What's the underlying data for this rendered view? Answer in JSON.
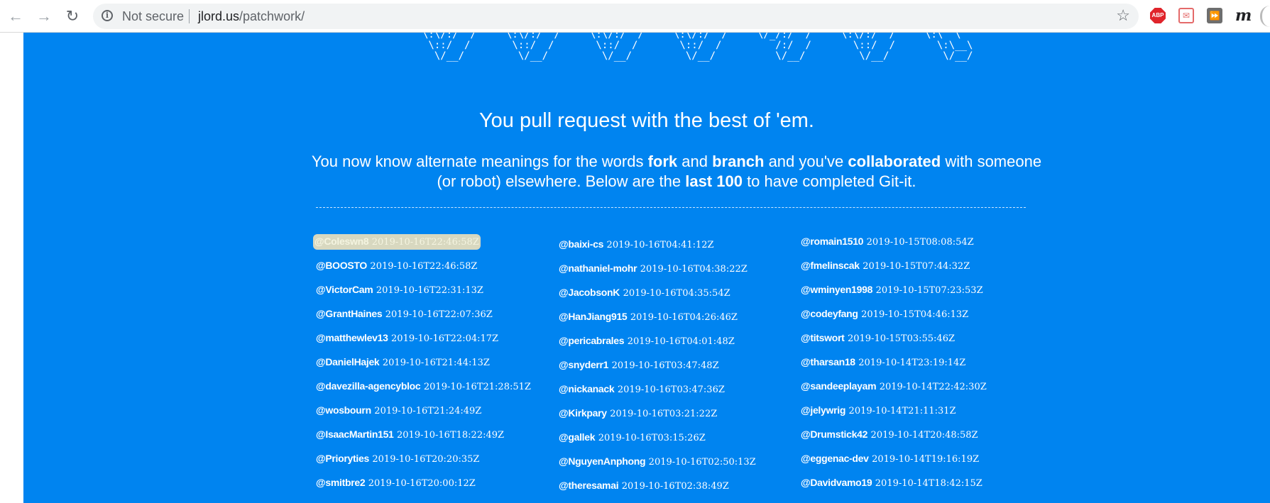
{
  "browser": {
    "back_icon": "←",
    "forward_icon": "→",
    "reload_icon": "↻",
    "info_glyph": "i",
    "security_label": "Not secure",
    "url_host": "jlord.us",
    "url_path": "/patchwork/",
    "star_icon": "☆",
    "extensions": {
      "abp_label": "ABP",
      "red_ext_glyph": "✉",
      "forward_ext_glyph": "⏩",
      "m_ext_glyph": "m"
    }
  },
  "ascii_art": "\\:\\/:/  /     \\:\\/:/  /     \\:\\/:/  /     \\:\\/:/  /     \\/_/:/  /     \\:\\/:/  /     \\:\\  \\\n \\::/  /       \\::/  /       \\::/  /       \\::/  /         /:/  /       \\::/  /       \\:\\__\\\n  \\/__/         \\/__/         \\/__/         \\/__/          \\/__/         \\/__/         \\/__/",
  "heading": {
    "prefix": "You ",
    "bold": "pull request",
    "suffix": " with the best of 'em."
  },
  "intro": {
    "t1": "You now know alternate meanings for the words ",
    "b1": "fork",
    "t2": " and ",
    "b2": "branch",
    "t3": " and you've ",
    "b3": "collaborated",
    "t4": " with someone (or robot) elsewhere. Below are the ",
    "b4": "last 100",
    "t5": " to have completed Git-it."
  },
  "completions": {
    "col1": [
      {
        "user": "@Coleswn8",
        "time": "2019-10-16T22:46:58Z"
      },
      {
        "user": "@BOOSTO",
        "time": "2019-10-16T22:46:58Z"
      },
      {
        "user": "@VictorCam",
        "time": "2019-10-16T22:31:13Z"
      },
      {
        "user": "@GrantHaines",
        "time": "2019-10-16T22:07:36Z"
      },
      {
        "user": "@matthewlev13",
        "time": "2019-10-16T22:04:17Z"
      },
      {
        "user": "@DanielHajek",
        "time": "2019-10-16T21:44:13Z"
      },
      {
        "user": "@davezilla-agencybloc",
        "time": "2019-10-16T21:28:51Z"
      },
      {
        "user": "@wosbourn",
        "time": "2019-10-16T21:24:49Z"
      },
      {
        "user": "@IsaacMartin151",
        "time": "2019-10-16T18:22:49Z"
      },
      {
        "user": "@Prioryties",
        "time": "2019-10-16T20:20:35Z"
      },
      {
        "user": "@smitbre2",
        "time": "2019-10-16T20:00:12Z"
      }
    ],
    "col2": [
      {
        "user": "@baixi-cs",
        "time": "2019-10-16T04:41:12Z"
      },
      {
        "user": "@nathaniel-mohr",
        "time": "2019-10-16T04:38:22Z"
      },
      {
        "user": "@JacobsonK",
        "time": "2019-10-16T04:35:54Z"
      },
      {
        "user": "@HanJiang915",
        "time": "2019-10-16T04:26:46Z"
      },
      {
        "user": "@pericabrales",
        "time": "2019-10-16T04:01:48Z"
      },
      {
        "user": "@snyderr1",
        "time": "2019-10-16T03:47:48Z"
      },
      {
        "user": "@nickanack",
        "time": "2019-10-16T03:47:36Z"
      },
      {
        "user": "@Kirkpary",
        "time": "2019-10-16T03:21:22Z"
      },
      {
        "user": "@gallek",
        "time": "2019-10-16T03:15:26Z"
      },
      {
        "user": "@NguyenAnphong",
        "time": "2019-10-16T02:50:13Z"
      },
      {
        "user": "@theresamai",
        "time": "2019-10-16T02:38:49Z"
      }
    ],
    "col3": [
      {
        "user": "@romain1510",
        "time": "2019-10-15T08:08:54Z"
      },
      {
        "user": "@fmelinscak",
        "time": "2019-10-15T07:44:32Z"
      },
      {
        "user": "@wminyen1998",
        "time": "2019-10-15T07:23:53Z"
      },
      {
        "user": "@codeyfang",
        "time": "2019-10-15T04:46:13Z"
      },
      {
        "user": "@titswort",
        "time": "2019-10-15T03:55:46Z"
      },
      {
        "user": "@tharsan18",
        "time": "2019-10-14T23:19:14Z"
      },
      {
        "user": "@sandeeplayam",
        "time": "2019-10-14T22:42:30Z"
      },
      {
        "user": "@jelywrig",
        "time": "2019-10-14T21:11:31Z"
      },
      {
        "user": "@Drumstick42",
        "time": "2019-10-14T20:48:58Z"
      },
      {
        "user": "@eggenac-dev",
        "time": "2019-10-14T19:16:19Z"
      },
      {
        "user": "@Davidvamo19",
        "time": "2019-10-14T18:42:15Z"
      }
    ]
  },
  "colors": {
    "page_background": "#0084f0",
    "text": "#ffffff",
    "highlight": "#d8d8c0"
  }
}
